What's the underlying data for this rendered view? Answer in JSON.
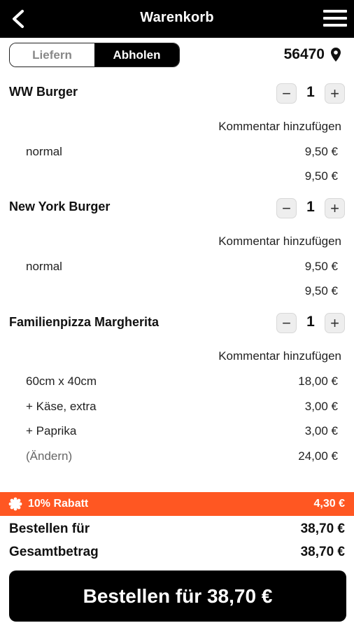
{
  "header": {
    "title": "Warenkorb"
  },
  "mode_toggle": {
    "deliver_label": "Liefern",
    "pickup_label": "Abholen",
    "selected": "Abholen"
  },
  "postal_code": "56470",
  "items": [
    {
      "name": "WW Burger",
      "quantity": "1",
      "comment_label": "Kommentar hinzufügen",
      "options": [
        {
          "label": "normal",
          "price": "9,50 €"
        }
      ],
      "subtotal": "9,50 €"
    },
    {
      "name": "New York Burger",
      "quantity": "1",
      "comment_label": "Kommentar hinzufügen",
      "options": [
        {
          "label": "normal",
          "price": "9,50 €"
        }
      ],
      "subtotal": "9,50 €"
    },
    {
      "name": "Familienpizza Margherita",
      "quantity": "1",
      "comment_label": "Kommentar hinzufügen",
      "options": [
        {
          "label": "60cm x 40cm",
          "price": "18,00 €"
        },
        {
          "label": "+ Käse, extra",
          "price": "3,00 €"
        },
        {
          "label": "+ Paprika",
          "price": "3,00 €"
        }
      ],
      "change_label": "(Ändern)",
      "subtotal": "24,00 €"
    }
  ],
  "discount": {
    "label": "10% Rabatt",
    "value": "4,30 €",
    "color": "#ff5722"
  },
  "summary": {
    "order_for_label": "Bestellen für",
    "order_for_value": "38,70 €",
    "total_label": "Gesamtbetrag",
    "total_value": "38,70 €"
  },
  "order_button": {
    "label": "Bestellen für 38,70 €"
  },
  "icons": [
    "back-arrow-icon",
    "hamburger-menu-icon",
    "location-pin-icon",
    "minus-icon",
    "plus-icon",
    "badge-icon"
  ]
}
